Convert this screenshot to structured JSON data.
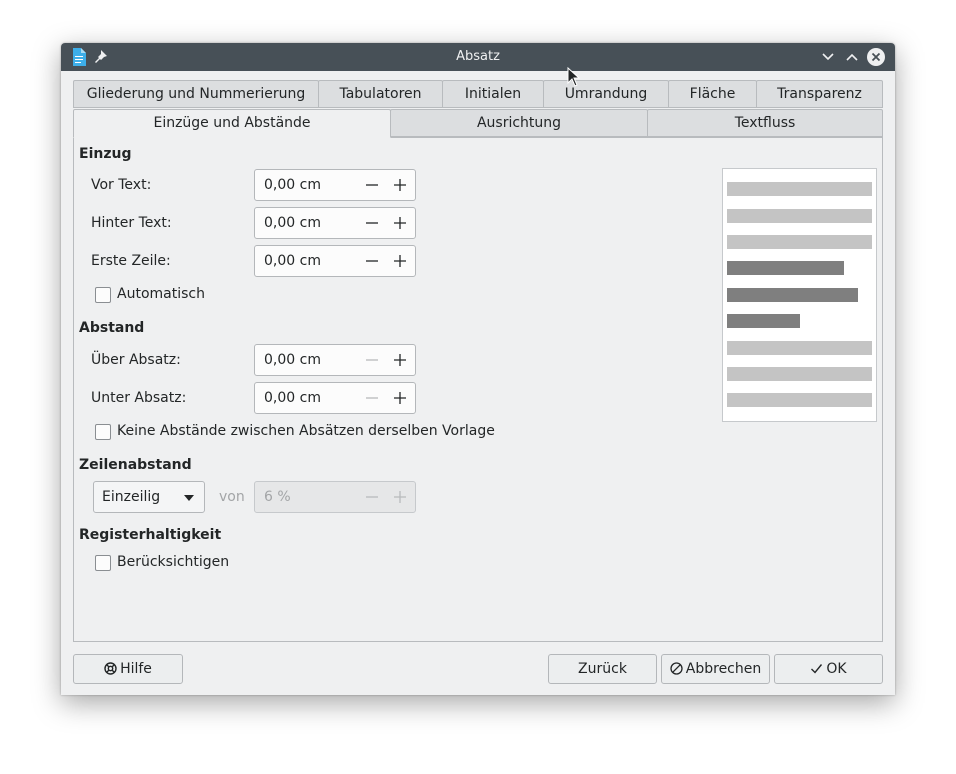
{
  "window": {
    "title": "Absatz"
  },
  "tabs_row1": [
    {
      "label": "Gliederung und Nummerierung"
    },
    {
      "label": "Tabulatoren"
    },
    {
      "label": "Initialen"
    },
    {
      "label": "Umrandung"
    },
    {
      "label": "Fläche"
    },
    {
      "label": "Transparenz"
    }
  ],
  "tabs_row2": [
    {
      "label": "Einzüge und Abstände",
      "active": true
    },
    {
      "label": "Ausrichtung"
    },
    {
      "label": "Textfluss"
    }
  ],
  "einzug": {
    "heading": "Einzug",
    "vor_text": {
      "label": "Vor Text:",
      "value": "0,00 cm"
    },
    "hinter_text": {
      "label": "Hinter Text:",
      "value": "0,00 cm"
    },
    "erste_zeile": {
      "label": "Erste Zeile:",
      "value": "0,00 cm"
    },
    "automatisch": {
      "label": "Automatisch",
      "checked": false
    }
  },
  "abstand": {
    "heading": "Abstand",
    "ueber": {
      "label": "Über Absatz:",
      "value": "0,00 cm"
    },
    "unter": {
      "label": "Unter Absatz:",
      "value": "0,00 cm"
    },
    "keine": {
      "label": "Keine Abstände zwischen Absätzen derselben Vorlage",
      "checked": false
    }
  },
  "zeilenabstand": {
    "heading": "Zeilenabstand",
    "mode": "Einzeilig",
    "von_label": "von",
    "value": "6 %"
  },
  "register": {
    "heading": "Registerhaltigkeit",
    "check": {
      "label": "Berücksichtigen",
      "checked": false
    }
  },
  "buttons": {
    "help": "Hilfe",
    "reset": "Zurück",
    "cancel": "Abbrechen",
    "ok": "OK"
  },
  "colors": {
    "titlebar": "#475057",
    "dialog_bg": "#eff0f1",
    "preview_light": "#c4c4c4",
    "preview_dark": "#7f7f7f",
    "doc_icon": "#3daee9"
  }
}
